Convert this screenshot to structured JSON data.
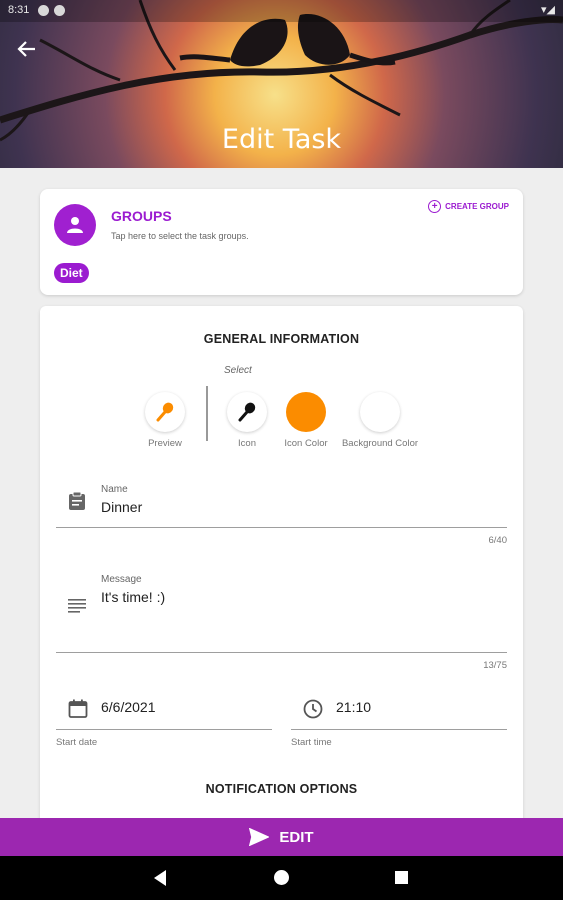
{
  "status_bar": {
    "time": "8:31"
  },
  "header": {
    "title": "Edit Task"
  },
  "groups": {
    "title": "GROUPS",
    "subtitle": "Tap here to select the task groups.",
    "create_label": "CREATE GROUP",
    "chip_label": "Diet"
  },
  "general": {
    "title": "GENERAL INFORMATION",
    "select_label": "Select",
    "preview_label": "Preview",
    "icon_label": "Icon",
    "icon_color_label": "Icon Color",
    "background_color_label": "Background Color",
    "icon_color": "#fb8c00",
    "background_color": "#ffffff"
  },
  "form": {
    "name": {
      "label": "Name",
      "value": "Dinner",
      "counter": "6/40"
    },
    "message": {
      "label": "Message",
      "value": "It's time! :)",
      "counter": "13/75"
    },
    "start_date": {
      "label": "Start date",
      "value": "6/6/2021"
    },
    "start_time": {
      "label": "Start time",
      "value": "21:10"
    }
  },
  "notification": {
    "title": "NOTIFICATION OPTIONS"
  },
  "action": {
    "edit_label": "EDIT"
  },
  "colors": {
    "accent": "#9c27b0",
    "accent_text": "#9b1bd0",
    "orange": "#fb8c00"
  }
}
